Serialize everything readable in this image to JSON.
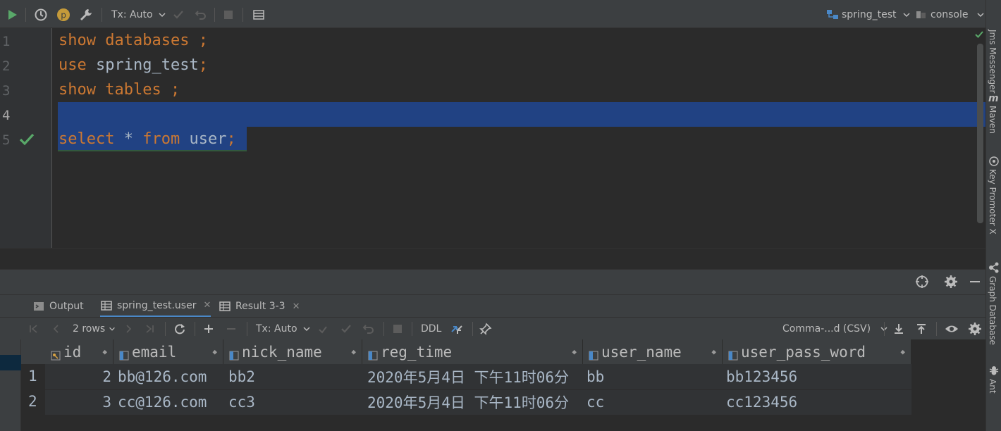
{
  "toolbar": {
    "tx_mode": "Tx: Auto",
    "datasource": "spring_test",
    "session": "console"
  },
  "editor": {
    "lines": [
      {
        "num": "1",
        "tokens": [
          {
            "t": "show",
            "k": "kw"
          },
          {
            "t": " ",
            "k": "id"
          },
          {
            "t": "databases",
            "k": "kw"
          },
          {
            "t": " ;",
            "k": "kw"
          }
        ]
      },
      {
        "num": "2",
        "tokens": [
          {
            "t": "use",
            "k": "kw"
          },
          {
            "t": " spring_test",
            "k": "id"
          },
          {
            "t": ";",
            "k": "kw"
          }
        ]
      },
      {
        "num": "3",
        "tokens": [
          {
            "t": "show",
            "k": "kw"
          },
          {
            "t": " ",
            "k": "id"
          },
          {
            "t": "tables",
            "k": "kw"
          },
          {
            "t": " ;",
            "k": "kw"
          }
        ]
      },
      {
        "num": "4",
        "tokens": []
      },
      {
        "num": "5",
        "tokens": [
          {
            "t": "select",
            "k": "kw"
          },
          {
            "t": " * ",
            "k": "id"
          },
          {
            "t": "from",
            "k": "kw"
          },
          {
            "t": " user",
            "k": "id"
          },
          {
            "t": ";",
            "k": "kw"
          }
        ]
      }
    ]
  },
  "tabs": [
    {
      "label": "Output"
    },
    {
      "label": "spring_test.user"
    },
    {
      "label": "Result 3-3"
    }
  ],
  "results_toolbar": {
    "rows_label": "2 rows",
    "tx_mode": "Tx: Auto",
    "ddl_label": "DDL",
    "export_format": "Comma-...d (CSV)"
  },
  "grid": {
    "columns": [
      "id",
      "email",
      "nick_name",
      "reg_time",
      "user_name",
      "user_pass_word"
    ],
    "rows": [
      {
        "num": "1",
        "cells": [
          "2",
          "bb@126.com",
          "bb2",
          "2020年5月4日 下午11时06分",
          "bb",
          "bb123456"
        ]
      },
      {
        "num": "2",
        "cells": [
          "3",
          "cc@126.com",
          "cc3",
          "2020年5月4日 下午11时06分",
          "cc",
          "cc123456"
        ]
      }
    ]
  },
  "right_tools": [
    "Jms Messenger",
    "Maven",
    "Key Promoter X",
    "Graph Database",
    "Ant"
  ],
  "colors": {
    "keyword": "#cc7832",
    "identifier": "#a9b7c6",
    "selection": "#214283",
    "run_green": "#59a869",
    "accent_blue": "#4a88c7"
  }
}
